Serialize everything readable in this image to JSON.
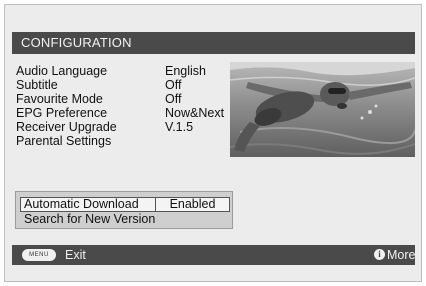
{
  "header": {
    "title": "CONFIGURATION"
  },
  "menu": {
    "items": [
      {
        "label": "Audio Language",
        "value": "English"
      },
      {
        "label": "Subtitle",
        "value": "Off"
      },
      {
        "label": "Favourite Mode",
        "value": "Off"
      },
      {
        "label": "EPG Preference",
        "value": "Now&Next"
      },
      {
        "label": "Receiver Upgrade",
        "value": "V.1.5"
      },
      {
        "label": "Parental Settings",
        "value": ""
      }
    ]
  },
  "submenu": {
    "selected": {
      "label": "Automatic Download",
      "value": "Enabled"
    },
    "second": {
      "label": "Search for New Version"
    }
  },
  "footer": {
    "menu_key": "MENU",
    "exit_label": "Exit",
    "info_icon_glyph": "i",
    "more_label": "More"
  },
  "preview": {
    "subject": "swimmer underwater photo"
  },
  "colors": {
    "bar": "#4a4a4a",
    "background": "#ececec",
    "panel": "#cfcfcf"
  }
}
